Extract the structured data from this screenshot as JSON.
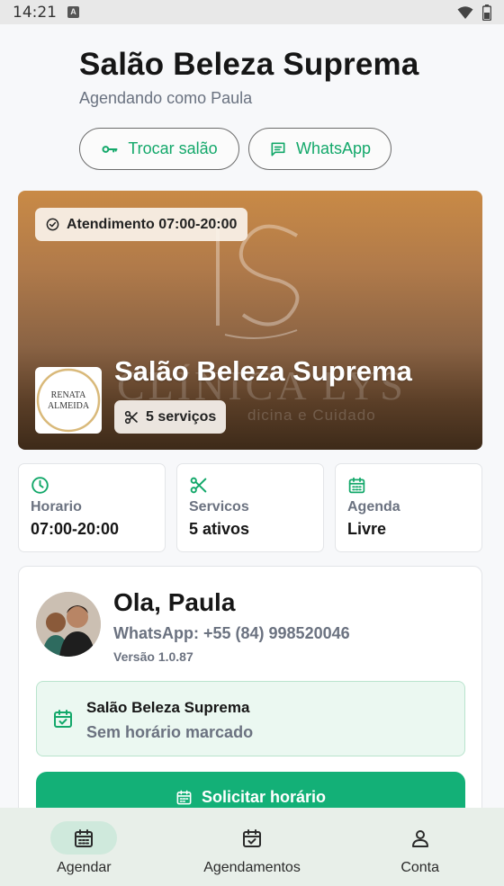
{
  "status_bar": {
    "time": "14:21",
    "notification_glyph": "A"
  },
  "header": {
    "title": "Salão Beleza Suprema",
    "subtitle": "Agendando como Paula",
    "switch_button": "Trocar salão",
    "whatsapp_button": "WhatsApp"
  },
  "hero": {
    "hours_badge": "Atendimento 07:00-20:00",
    "salon_name": "Salão Beleza Suprema",
    "services_chip": "5 serviços",
    "logo_text_line1": "RENATA",
    "logo_text_line2": "ALMEIDA",
    "background_watermark_big": "CLÍNICA LYS",
    "background_watermark_small": "dicina e Cuidado"
  },
  "stats": [
    {
      "icon": "clock-icon",
      "label": "Horario",
      "value": "07:00-20:00"
    },
    {
      "icon": "scissors-icon",
      "label": "Servicos",
      "value": "5 ativos"
    },
    {
      "icon": "calendar-icon",
      "label": "Agenda",
      "value": "Livre"
    }
  ],
  "profile": {
    "greeting": "Ola, Paula",
    "whatsapp": "WhatsApp: +55 (84) 998520046",
    "version": "Versão 1.0.87",
    "appointment_salon": "Salão Beleza Suprema",
    "appointment_status": "Sem horário marcado",
    "cta_label": "Solicitar horário"
  },
  "bottom_nav": [
    {
      "label": "Agendar",
      "icon": "calendar-icon",
      "active": true
    },
    {
      "label": "Agendamentos",
      "icon": "calendar-check-icon",
      "active": false
    },
    {
      "label": "Conta",
      "icon": "person-icon",
      "active": false
    }
  ],
  "colors": {
    "accent": "#13b077",
    "accent_text": "#13a86a",
    "muted": "#6b7280",
    "nav_bg": "#e8efe9"
  }
}
